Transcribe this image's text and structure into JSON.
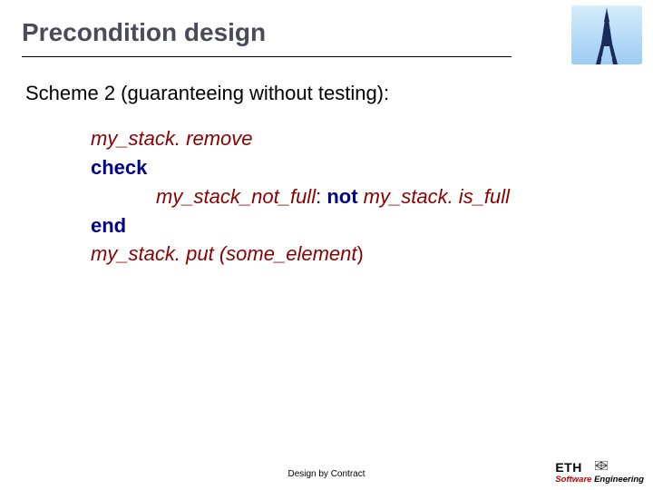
{
  "title": "Precondition design",
  "intro": "Scheme 2 (guaranteeing without testing):",
  "code": {
    "line1_italic": "my_stack",
    "line1_rest": ". remove",
    "check": "check",
    "cond_label": "my_stack_not_full",
    "cond_colon": ": ",
    "not_kw": "not ",
    "cond_obj": "my_stack",
    "cond_rest": ". is_full",
    "end": "end",
    "line5_italic": "my_stack",
    "line5_rest": ". put (",
    "line5_arg": "some_element",
    "line5_close": ")"
  },
  "footer": {
    "center": "Design by Contract",
    "eth": "ETH",
    "software": "Software ",
    "engineering": "Engineering"
  }
}
